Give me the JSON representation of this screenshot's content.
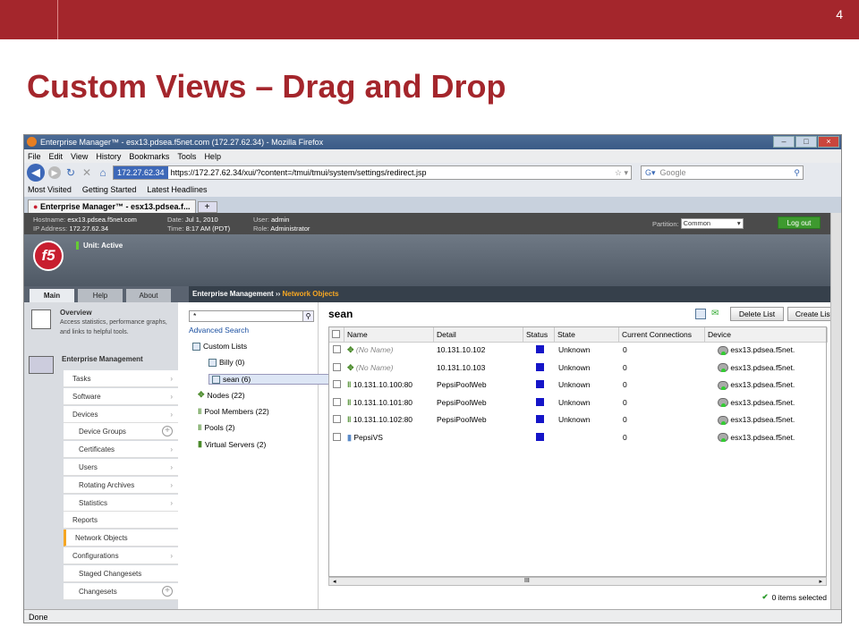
{
  "slide": {
    "number": "4",
    "title": "Custom Views – Drag and Drop"
  },
  "browser": {
    "window_title": "Enterprise Manager™ - esx13.pdsea.f5net.com (172.27.62.34) - Mozilla Firefox",
    "menu": [
      "File",
      "Edit",
      "View",
      "History",
      "Bookmarks",
      "Tools",
      "Help"
    ],
    "url_ip": "172.27.62.34",
    "url": "https://172.27.62.34/xui/?content=/tmui/tmui/system/settings/redirect.jsp",
    "search_placeholder": "Google",
    "bookmarks": [
      "Most Visited",
      "Getting Started",
      "Latest Headlines"
    ],
    "tab_title": "Enterprise Manager™ - esx13.pdsea.f...",
    "tab_new": "+",
    "status": "Done"
  },
  "header": {
    "hostname_label": "Hostname:",
    "hostname": "esx13.pdsea.f5net.com",
    "ip_label": "IP Address:",
    "ip": "172.27.62.34",
    "date_label": "Date:",
    "date": "Jul 1, 2010",
    "time_label": "Time:",
    "time": "8:17 AM (PDT)",
    "user_label": "User:",
    "user": "admin",
    "role_label": "Role:",
    "role": "Administrator",
    "partition_label": "Partition:",
    "partition": "Common",
    "logout": "Log out",
    "logo": "f5",
    "unit": "Unit: Active"
  },
  "tabs": [
    "Main",
    "Help",
    "About"
  ],
  "breadcrumb": {
    "root": "Enterprise Management",
    "sep": "››",
    "current": "Network Objects"
  },
  "sidebar": {
    "overview_title": "Overview",
    "overview_text": "Access statistics, performance graphs, and links to helpful tools.",
    "section": "Enterprise Management",
    "items": [
      {
        "label": "Tasks",
        "sub": false,
        "arrow": "›"
      },
      {
        "label": "Software",
        "sub": false,
        "arrow": "›"
      },
      {
        "label": "Devices",
        "sub": false,
        "arrow": "›"
      },
      {
        "label": "Device Groups",
        "sub": true,
        "plus": "+"
      },
      {
        "label": "Certificates",
        "sub": true,
        "arrow": "›"
      },
      {
        "label": "Users",
        "sub": true,
        "arrow": "›"
      },
      {
        "label": "Rotating Archives",
        "sub": true,
        "arrow": "›"
      },
      {
        "label": "Statistics",
        "sub": true,
        "arrow": "›"
      },
      {
        "label": "Reports",
        "sub": false
      },
      {
        "label": "Network Objects",
        "sub": false,
        "selected": true
      },
      {
        "label": "Configurations",
        "sub": false,
        "arrow": "›"
      },
      {
        "label": "Staged Changesets",
        "sub": true
      },
      {
        "label": "Changesets",
        "sub": true,
        "plus": "+"
      }
    ]
  },
  "tree": {
    "filter_value": "*",
    "advanced_search": "Advanced Search",
    "nodes": [
      "Custom Lists",
      "Billy (0)",
      "sean (6)",
      "Nodes (22)",
      "Pool Members (22)",
      "Pools (2)",
      "Virtual Servers (2)"
    ]
  },
  "content": {
    "title": "sean",
    "delete_button": "Delete List",
    "create_button": "Create List...",
    "columns": [
      "Name",
      "Detail",
      "Status",
      "State",
      "Current Connections",
      "Device"
    ],
    "rows": [
      {
        "name": "(No Name)",
        "detail": "10.131.10.102",
        "state": "Unknown",
        "conn": "0",
        "device": "esx13.pdsea.f5net.",
        "type": "node"
      },
      {
        "name": "(No Name)",
        "detail": "10.131.10.103",
        "state": "Unknown",
        "conn": "0",
        "device": "esx13.pdsea.f5net.",
        "type": "node"
      },
      {
        "name": "10.131.10.100:80",
        "detail": "PepsiPoolWeb",
        "state": "Unknown",
        "conn": "0",
        "device": "esx13.pdsea.f5net.",
        "type": "member"
      },
      {
        "name": "10.131.10.101:80",
        "detail": "PepsiPoolWeb",
        "state": "Unknown",
        "conn": "0",
        "device": "esx13.pdsea.f5net.",
        "type": "member"
      },
      {
        "name": "10.131.10.102:80",
        "detail": "PepsiPoolWeb",
        "state": "Unknown",
        "conn": "0",
        "device": "esx13.pdsea.f5net.",
        "type": "member"
      },
      {
        "name": "PepsiVS",
        "detail": "",
        "state": "",
        "conn": "0",
        "device": "esx13.pdsea.f5net.",
        "type": "vs"
      }
    ],
    "hscroll_mid": "III",
    "selected_count": "0 items selected"
  }
}
